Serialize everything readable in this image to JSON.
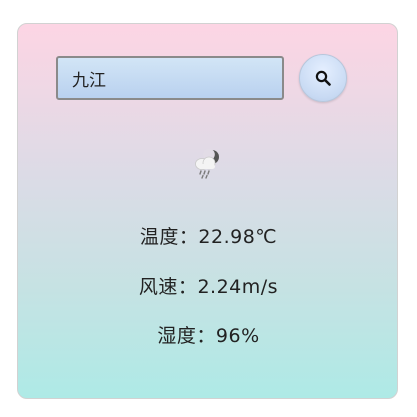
{
  "search": {
    "value": "九江",
    "placeholder": ""
  },
  "weather": {
    "icon": "cloud-rain-night-icon",
    "temperature_label": "温度：",
    "temperature_value": "22.98℃",
    "wind_label": "风速：",
    "wind_value": "2.24m/s",
    "humidity_label": "湿度：",
    "humidity_value": "96%"
  },
  "colors": {
    "card_top": "#fdd5e4",
    "card_bottom": "#aeeae6",
    "input_bg": "#c4dbf3",
    "button_bg": "#c8daf3"
  }
}
